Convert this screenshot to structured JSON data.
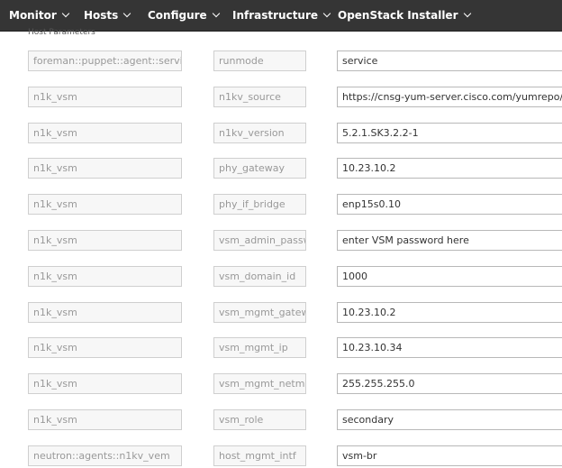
{
  "nav": {
    "items": [
      "Monitor",
      "Hosts",
      "Configure",
      "Infrastructure",
      "OpenStack Installer"
    ]
  },
  "section_title": "Host Parameters",
  "params": [
    {
      "class": "foreman::puppet::agent::service",
      "name": "runmode",
      "value": "service"
    },
    {
      "class": "n1k_vsm",
      "name": "n1kv_source",
      "value": "https://cnsg-yum-server.cisco.com/yumrepo/"
    },
    {
      "class": "n1k_vsm",
      "name": "n1kv_version",
      "value": "5.2.1.SK3.2.2-1"
    },
    {
      "class": "n1k_vsm",
      "name": "phy_gateway",
      "value": "10.23.10.2"
    },
    {
      "class": "n1k_vsm",
      "name": "phy_if_bridge",
      "value": "enp15s0.10"
    },
    {
      "class": "n1k_vsm",
      "name": "vsm_admin_passwd",
      "value": "enter VSM password here"
    },
    {
      "class": "n1k_vsm",
      "name": "vsm_domain_id",
      "value": "1000"
    },
    {
      "class": "n1k_vsm",
      "name": "vsm_mgmt_gateway",
      "value": "10.23.10.2"
    },
    {
      "class": "n1k_vsm",
      "name": "vsm_mgmt_ip",
      "value": "10.23.10.34"
    },
    {
      "class": "n1k_vsm",
      "name": "vsm_mgmt_netmask",
      "value": "255.255.255.0"
    },
    {
      "class": "n1k_vsm",
      "name": "vsm_role",
      "value": "secondary"
    },
    {
      "class": "neutron::agents::n1kv_vem",
      "name": "host_mgmt_intf",
      "value": "vsm-br"
    }
  ],
  "colors": {
    "navbar": "#353535",
    "nav_text": "#ffffff",
    "readonly_text": "#999999",
    "value_text": "#333333"
  }
}
